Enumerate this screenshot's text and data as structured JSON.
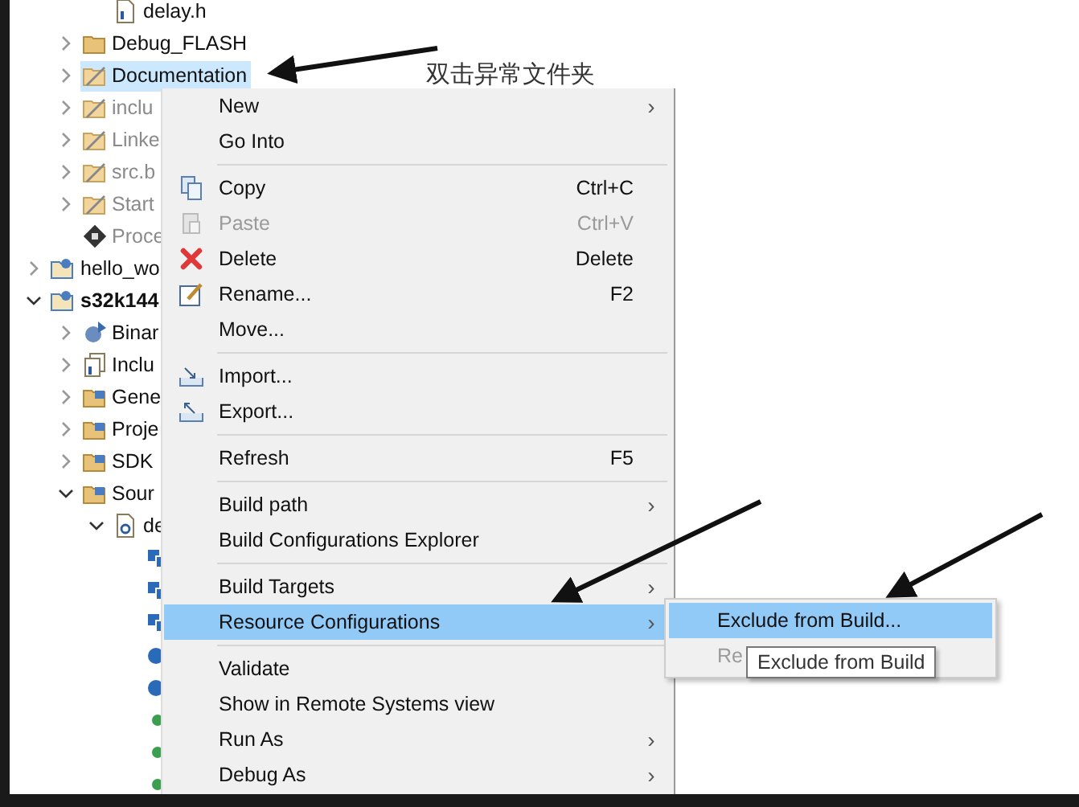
{
  "tree": [
    {
      "children": [
        {
          "children": [
            {
              "label": "delay.h",
              "kind": "h-file",
              "disabled": false,
              "selected": false
            }
          ]
        },
        {
          "label": "Debug_FLASH",
          "kind": "folder",
          "expanded": false,
          "disabled": false,
          "selected": false
        },
        {
          "label": "Documentation",
          "kind": "excluded-folder",
          "expanded": false,
          "disabled": false,
          "selected": true
        },
        {
          "label": "inclu",
          "kind": "excluded-folder",
          "expanded": false,
          "disabled": true,
          "selected": false
        },
        {
          "label": "Linke",
          "kind": "excluded-folder",
          "expanded": false,
          "disabled": true,
          "selected": false
        },
        {
          "label": "src.b",
          "kind": "excluded-folder",
          "expanded": false,
          "disabled": true,
          "selected": false
        },
        {
          "label": "Start",
          "kind": "excluded-folder",
          "expanded": false,
          "disabled": true,
          "selected": false
        },
        {
          "label": "Proce",
          "kind": "chip",
          "disabled": true,
          "selected": false
        }
      ]
    },
    {
      "label": "hello_wo",
      "kind": "project",
      "expanded": false,
      "disabled": false,
      "selected": false
    },
    {
      "label": "s32k144",
      "kind": "project",
      "expanded": true,
      "bold": true,
      "disabled": false,
      "selected": false,
      "children": [
        {
          "label": "Binar",
          "kind": "binaries",
          "expanded": false,
          "disabled": false,
          "selected": false
        },
        {
          "label": "Inclu",
          "kind": "includes",
          "expanded": false,
          "disabled": false,
          "selected": false
        },
        {
          "label": "Gene",
          "kind": "source-folder",
          "expanded": false,
          "disabled": false,
          "selected": false
        },
        {
          "label": "Proje",
          "kind": "source-folder",
          "expanded": false,
          "disabled": false,
          "selected": false
        },
        {
          "label": "SDK",
          "kind": "source-folder",
          "expanded": false,
          "disabled": false,
          "selected": false
        },
        {
          "label": "Sour",
          "kind": "source-folder",
          "expanded": true,
          "disabled": false,
          "selected": false,
          "children": [
            {
              "label": "de",
              "kind": "c-file",
              "expanded": true,
              "disabled": false,
              "selected": false,
              "children": [
                {
                  "kind": "struct",
                  "selected": false
                },
                {
                  "kind": "struct",
                  "selected": false
                },
                {
                  "kind": "struct",
                  "selected": false
                },
                {
                  "kind": "variable",
                  "selected": false
                },
                {
                  "kind": "variable",
                  "selected": false
                },
                {
                  "kind": "function",
                  "selected": false
                },
                {
                  "kind": "function",
                  "selected": false
                },
                {
                  "kind": "function",
                  "selected": false
                }
              ]
            }
          ]
        }
      ]
    }
  ],
  "context_menu": [
    {
      "kind": "plain",
      "label": "New",
      "submenu": true,
      "disabled": false,
      "selected": false
    },
    {
      "kind": "plain",
      "label": "Go Into",
      "disabled": false,
      "selected": false
    },
    {
      "kind": "separator"
    },
    {
      "kind": "copy",
      "label": "Copy",
      "shortcut": "Ctrl+C",
      "disabled": false,
      "selected": false
    },
    {
      "kind": "paste",
      "label": "Paste",
      "shortcut": "Ctrl+V",
      "disabled": true,
      "selected": false
    },
    {
      "kind": "delete",
      "label": "Delete",
      "shortcut": "Delete",
      "disabled": false,
      "selected": false
    },
    {
      "kind": "rename",
      "label": "Rename...",
      "shortcut": "F2",
      "disabled": false,
      "selected": false
    },
    {
      "kind": "plain",
      "label": "Move...",
      "disabled": false,
      "selected": false
    },
    {
      "kind": "separator"
    },
    {
      "kind": "import",
      "label": "Import...",
      "disabled": false,
      "selected": false
    },
    {
      "kind": "export",
      "label": "Export...",
      "disabled": false,
      "selected": false
    },
    {
      "kind": "separator"
    },
    {
      "kind": "plain",
      "label": "Refresh",
      "shortcut": "F5",
      "disabled": false,
      "selected": false
    },
    {
      "kind": "separator"
    },
    {
      "kind": "plain",
      "label": "Build path",
      "submenu": true,
      "disabled": false,
      "selected": false
    },
    {
      "kind": "plain",
      "label": "Build Configurations Explorer",
      "disabled": false,
      "selected": false
    },
    {
      "kind": "separator"
    },
    {
      "kind": "plain",
      "label": "Build Targets",
      "submenu": true,
      "disabled": false,
      "selected": false
    },
    {
      "kind": "plain",
      "label": "Resource Configurations",
      "submenu": true,
      "disabled": false,
      "selected": true
    },
    {
      "kind": "separator"
    },
    {
      "kind": "plain",
      "label": "Validate",
      "disabled": false,
      "selected": false
    },
    {
      "kind": "plain",
      "label": "Show in Remote Systems view",
      "disabled": false,
      "selected": false
    },
    {
      "kind": "plain",
      "label": "Run As",
      "submenu": true,
      "disabled": false,
      "selected": false
    },
    {
      "kind": "plain",
      "label": "Debug As",
      "submenu": true,
      "disabled": false,
      "selected": false
    }
  ],
  "submenu": [
    {
      "label": "Exclude from Build...",
      "disabled": false,
      "selected": true
    },
    {
      "label": "Re",
      "disabled": true,
      "selected": false
    }
  ],
  "tooltip": "Exclude from Build",
  "annotation": "双击异常文件夹",
  "chevron": "›"
}
